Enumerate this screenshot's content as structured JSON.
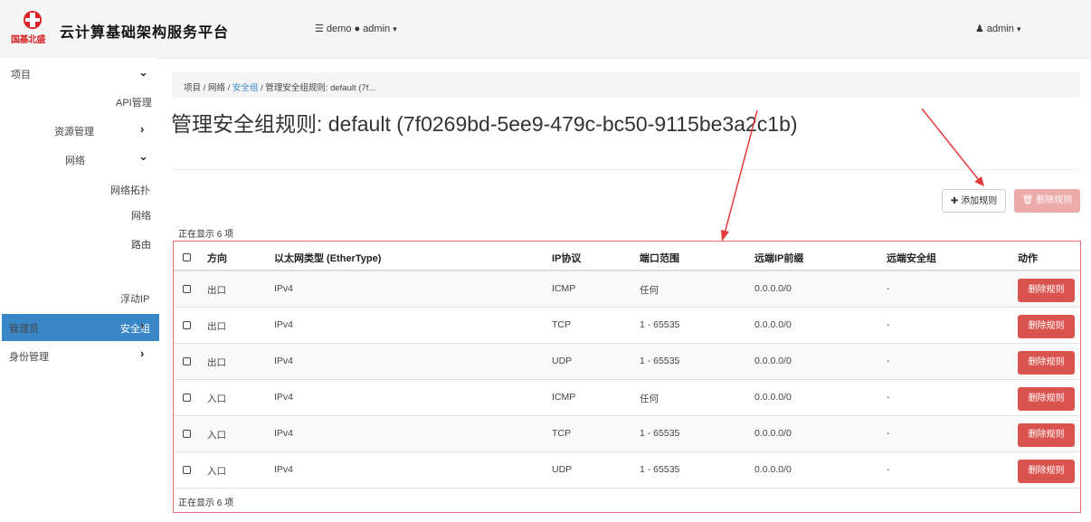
{
  "topbar": {
    "logo_text": "国基北盛",
    "brand": "云计算基础架构服务平台",
    "project_selector": "demo ● admin",
    "user_menu": "admin"
  },
  "sidebar": {
    "items": [
      {
        "label": "项目"
      },
      {
        "label": "API管理"
      },
      {
        "label": "资源管理"
      },
      {
        "label": "网络"
      },
      {
        "label": "网络拓扑"
      },
      {
        "label": "网络"
      },
      {
        "label": "路由"
      },
      {
        "label": "安全组"
      },
      {
        "label": "浮动IP"
      },
      {
        "label": "管理员"
      },
      {
        "label": "身份管理"
      }
    ]
  },
  "breadcrumb": {
    "items": [
      "项目",
      "网络",
      "安全组",
      "管理安全组规则: default (7f..."
    ],
    "separator": "/"
  },
  "page": {
    "title": "管理安全组规则: default (7f0269bd-5ee9-479c-bc50-9115be3a2c1b)"
  },
  "actions": {
    "add_rule": "添加规则",
    "delete_rules": "删除规则"
  },
  "table": {
    "showing_top": "正在显示 6 项",
    "showing_bottom": "正在显示 6 项",
    "headers": [
      "方向",
      "以太网类型 (EtherType)",
      "IP协议",
      "端口范围",
      "远端IP前缀",
      "远端安全组",
      "动作"
    ],
    "rows": [
      {
        "direction": "出口",
        "ethertype": "IPv4",
        "protocol": "ICMP",
        "ports": "任何",
        "prefix": "0.0.0.0/0",
        "group": "-",
        "action": "删除规则"
      },
      {
        "direction": "出口",
        "ethertype": "IPv4",
        "protocol": "TCP",
        "ports": "1 - 65535",
        "prefix": "0.0.0.0/0",
        "group": "-",
        "action": "删除规则"
      },
      {
        "direction": "出口",
        "ethertype": "IPv4",
        "protocol": "UDP",
        "ports": "1 - 65535",
        "prefix": "0.0.0.0/0",
        "group": "-",
        "action": "删除规则"
      },
      {
        "direction": "入口",
        "ethertype": "IPv4",
        "protocol": "ICMP",
        "ports": "任何",
        "prefix": "0.0.0.0/0",
        "group": "-",
        "action": "删除规则"
      },
      {
        "direction": "入口",
        "ethertype": "IPv4",
        "protocol": "TCP",
        "ports": "1 - 65535",
        "prefix": "0.0.0.0/0",
        "group": "-",
        "action": "删除规则"
      },
      {
        "direction": "入口",
        "ethertype": "IPv4",
        "protocol": "UDP",
        "ports": "1 - 65535",
        "prefix": "0.0.0.0/0",
        "group": "-",
        "action": "删除规则"
      }
    ]
  },
  "colors": {
    "accent": "#3a87c8",
    "danger": "#d9534f",
    "annotation": "#e23b3b"
  }
}
